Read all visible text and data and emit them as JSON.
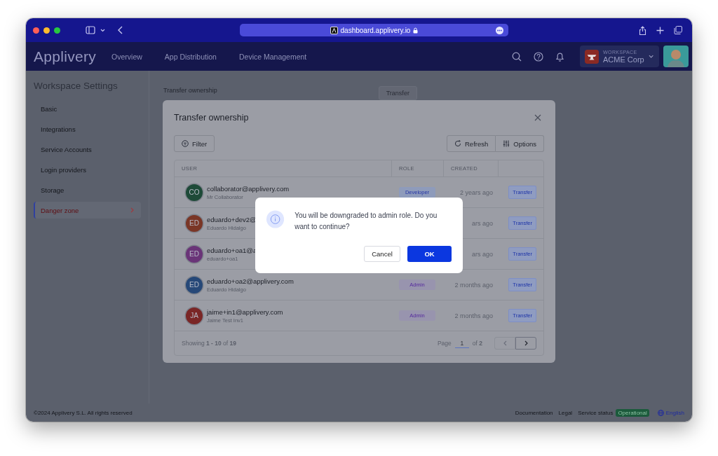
{
  "browser": {
    "url": "dashboard.applivery.io"
  },
  "nav": {
    "logo": "Applivery",
    "links": [
      {
        "label": "Overview"
      },
      {
        "label": "App Distribution"
      },
      {
        "label": "Device Management"
      }
    ],
    "workspace": {
      "caption": "WORKSPACE",
      "name": "ACME Corp"
    }
  },
  "sidebar": {
    "title": "Workspace Settings",
    "items": [
      {
        "label": "Basic",
        "selected": false
      },
      {
        "label": "Integrations",
        "selected": false
      },
      {
        "label": "Service Accounts",
        "selected": false
      },
      {
        "label": "Login providers",
        "selected": false
      },
      {
        "label": "Storage",
        "selected": false
      },
      {
        "label": "Danger zone",
        "selected": true
      }
    ]
  },
  "section": {
    "title": "Transfer ownership",
    "button": "Transfer"
  },
  "modal": {
    "title": "Transfer ownership",
    "filter": "Filter",
    "refresh": "Refresh",
    "options": "Options",
    "columns": [
      "USER",
      "ROLE",
      "CREATED"
    ],
    "rows": [
      {
        "initials": "CO",
        "color": "#1e4a38",
        "email": "collaborator@applivery.com",
        "name": "Mr Collaborator",
        "role": {
          "label": "Developer",
          "kind": "developer"
        },
        "created": "2 years ago",
        "action": "Transfer"
      },
      {
        "initials": "ED",
        "color": "#7a3626",
        "email": "eduardo+dev2@",
        "name": "Eduardo Hidalgo",
        "created": "ars ago",
        "action": "Transfer"
      },
      {
        "initials": "ED",
        "color": "#6a3478",
        "email": "eduardo+oa1@a",
        "name": "eduardo+oa1",
        "created": "ars ago",
        "action": "Transfer"
      },
      {
        "initials": "ED",
        "color": "#264878",
        "email": "eduardo+oa2@applivery.com",
        "name": "Eduardo Hidalgo",
        "role": {
          "label": "Admin",
          "kind": "admin"
        },
        "created": "2 months ago",
        "action": "Transfer"
      },
      {
        "initials": "JA",
        "color": "#7a2626",
        "email": "jaime+in1@applivery.com",
        "name": "Jaime Test Inv1",
        "role": {
          "label": "Admin",
          "kind": "admin"
        },
        "created": "2 months ago",
        "action": "Transfer"
      }
    ],
    "showing": "Showing **1 - 10** of **19**",
    "page_label": "Page",
    "page": "1",
    "page_total": "of **2**"
  },
  "dialog": {
    "message": "You will be downgraded to admin role. Do you want to continue?",
    "cancel": "Cancel",
    "ok": "OK"
  },
  "footer": {
    "copyright": "©2024 Applivery S.L. All rights reserved",
    "links": [
      "Documentation",
      "Legal"
    ],
    "status_label": "Service status",
    "status": "Operational",
    "language": "English"
  }
}
